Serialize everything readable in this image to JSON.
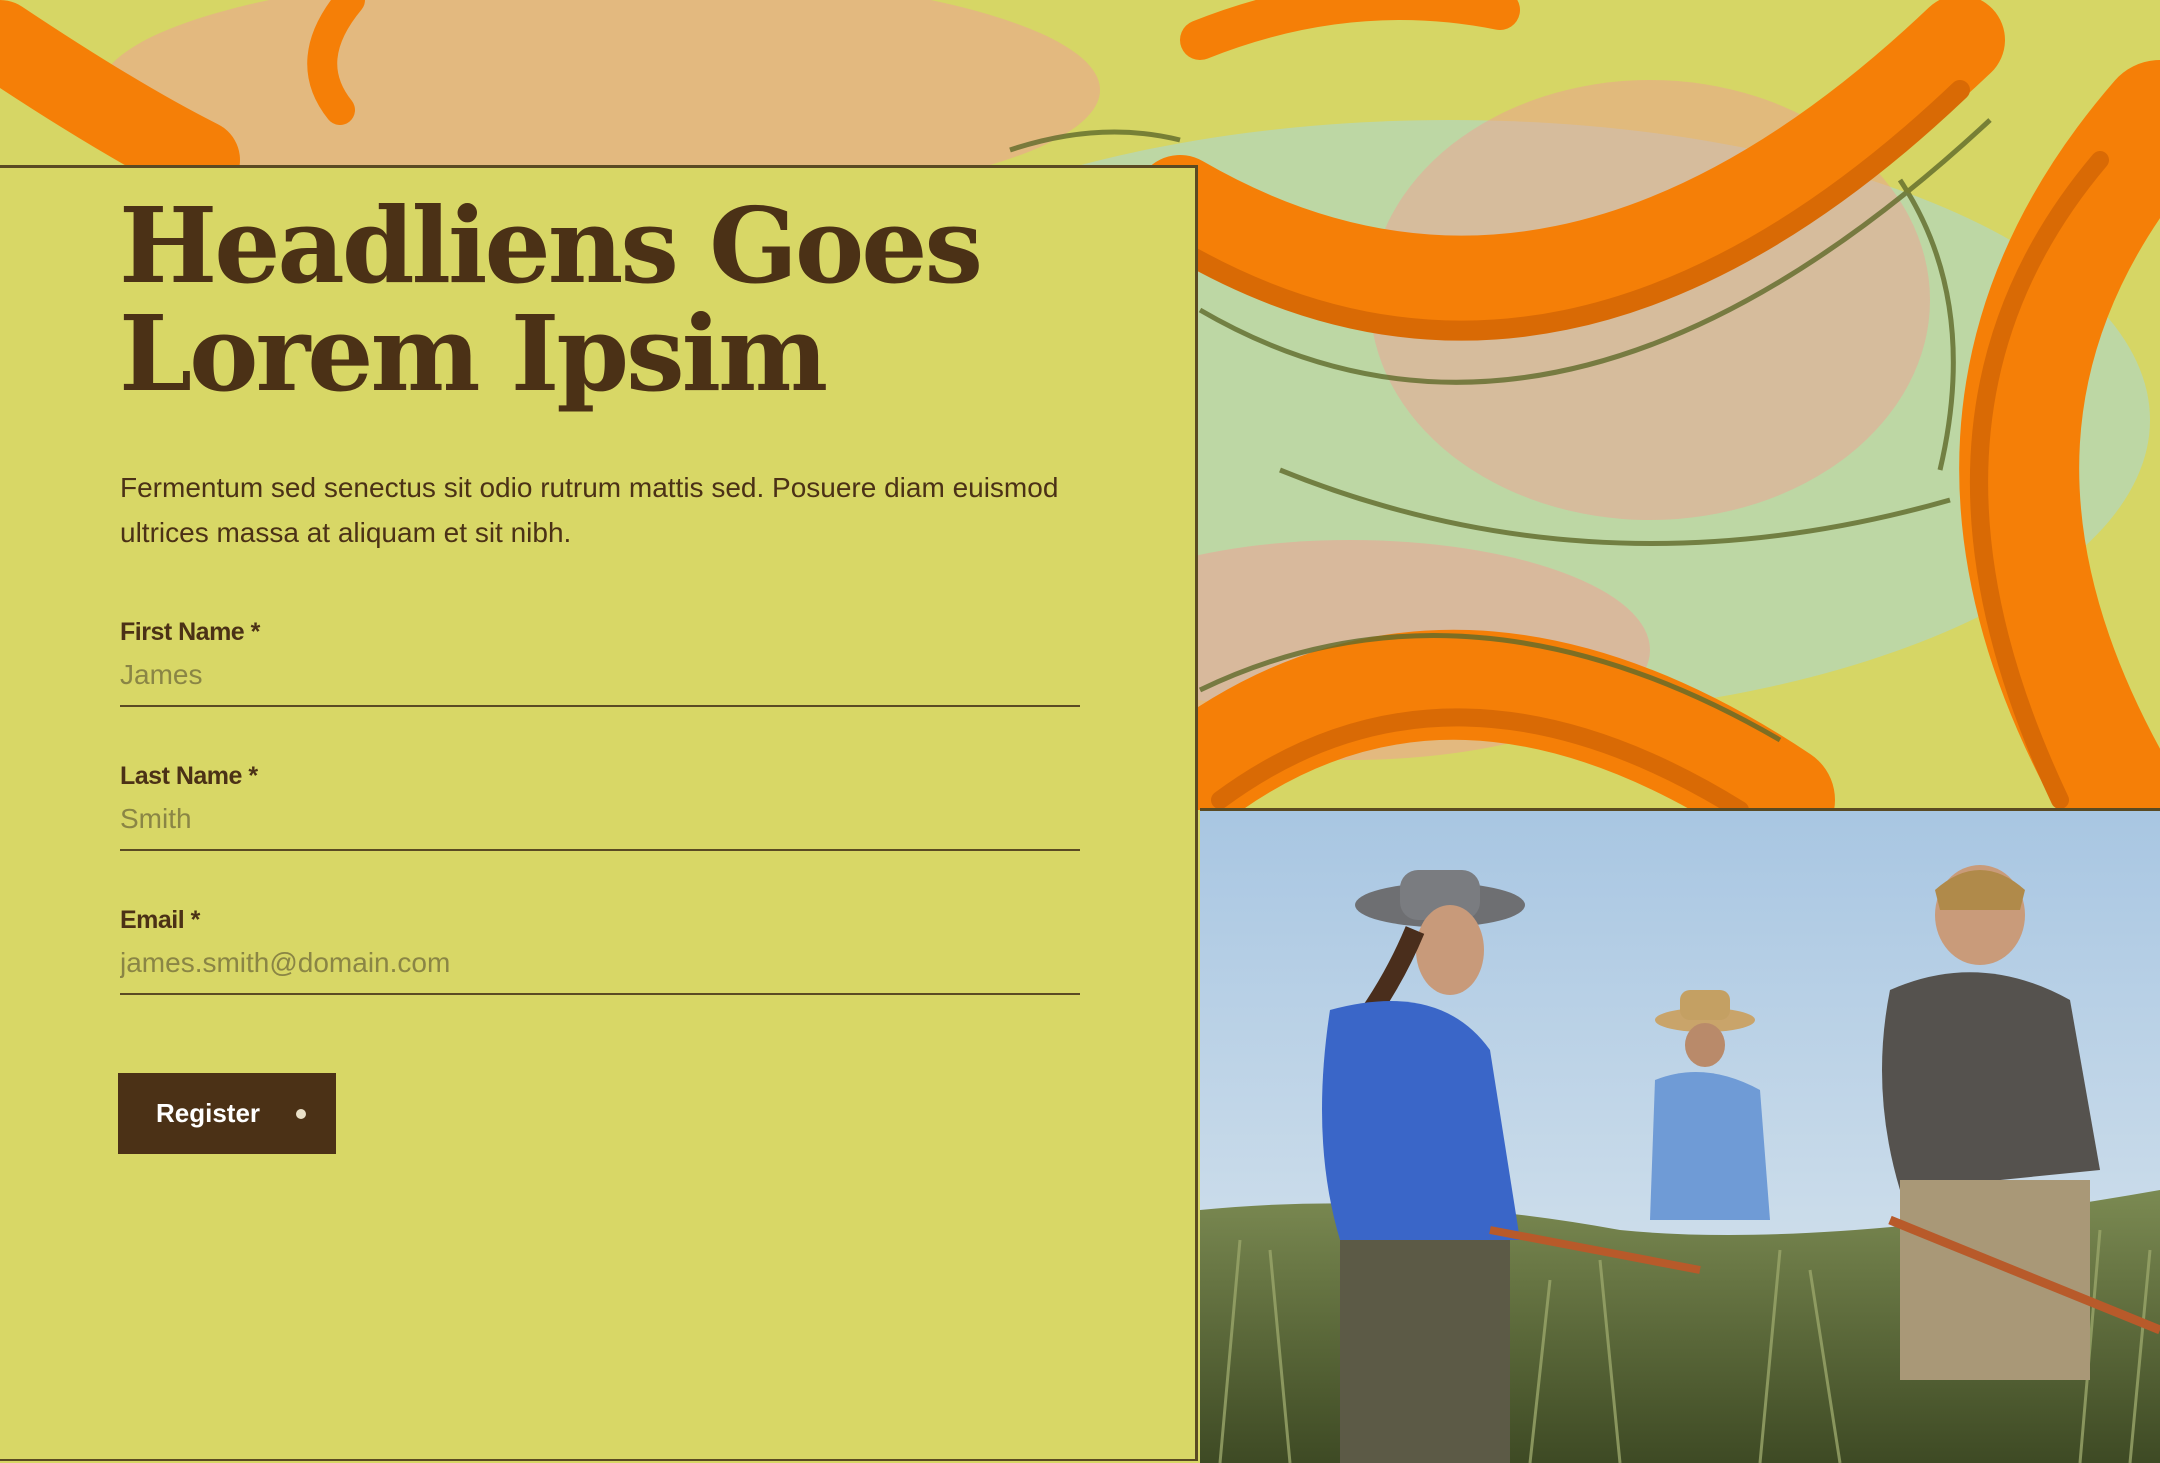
{
  "hero": {
    "title": "Headliens Goes Lorem Ipsim",
    "description": "Fermentum sed senectus sit odio rutrum mattis sed. Posuere diam euismod ultrices massa at aliquam et sit nibh."
  },
  "form": {
    "first_name": {
      "label": "First Name *",
      "placeholder": "James"
    },
    "last_name": {
      "label": "Last Name *",
      "placeholder": "Smith"
    },
    "email": {
      "label": "Email *",
      "placeholder": "james.smith@domain.com"
    },
    "submit_label": "Register"
  },
  "colors": {
    "panel_bg": "#d8d766",
    "text_brown": "#4b3116",
    "art_orange": "#f57f07",
    "art_pink": "#f19a9a",
    "art_blue": "#a9d8dc"
  },
  "icons": {
    "register_indicator": "dot-icon"
  }
}
